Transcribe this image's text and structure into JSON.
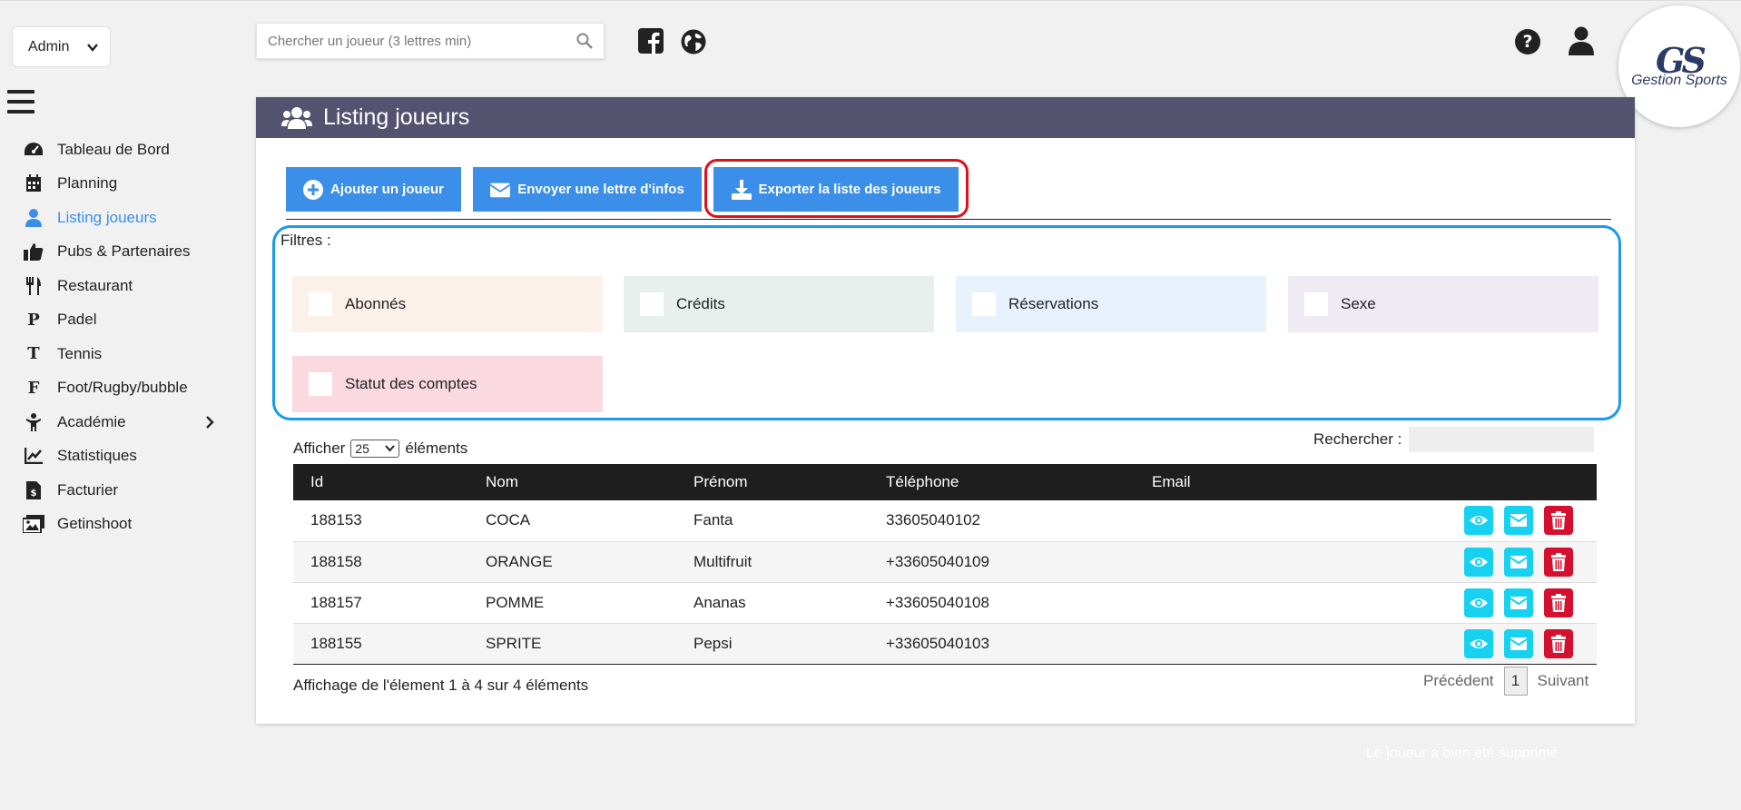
{
  "topbar": {
    "role_select": "Admin",
    "search_placeholder": "Chercher un joueur (3 lettres min)",
    "logo_name": "Gestion Sports",
    "logo_monogram": "GS"
  },
  "sidebar": {
    "items": [
      {
        "label": "Tableau de Bord",
        "icon": "dashboard-icon"
      },
      {
        "label": "Planning",
        "icon": "calendar-icon"
      },
      {
        "label": "Listing joueurs",
        "icon": "user-icon",
        "active": true
      },
      {
        "label": "Pubs & Partenaires",
        "icon": "thumbs-up-icon"
      },
      {
        "label": "Restaurant",
        "icon": "utensils-icon"
      },
      {
        "label": "Padel",
        "icon": "letter-p-icon",
        "glyph": "P"
      },
      {
        "label": "Tennis",
        "icon": "letter-t-icon",
        "glyph": "T"
      },
      {
        "label": "Foot/Rugby/bubble",
        "icon": "letter-f-icon",
        "glyph": "F"
      },
      {
        "label": "Académie",
        "icon": "child-icon"
      },
      {
        "label": "Statistiques",
        "icon": "chart-line-icon"
      },
      {
        "label": "Facturier",
        "icon": "invoice-icon"
      },
      {
        "label": "Getinshoot",
        "icon": "images-icon"
      }
    ]
  },
  "main": {
    "title": "Listing joueurs",
    "buttons": {
      "add": "Ajouter un joueur",
      "mail": "Envoyer une lettre d'infos",
      "export": "Exporter la liste des joueurs"
    },
    "filters_label": "Filtres :",
    "filters": [
      "Abonnés",
      "Crédits",
      "Réservations",
      "Sexe",
      "Statut des comptes"
    ],
    "show": {
      "before": "Afficher",
      "value": "25",
      "after": "éléments"
    },
    "search_label": "Rechercher :",
    "columns": [
      "Id",
      "Nom",
      "Prénom",
      "Téléphone",
      "Email"
    ],
    "rows": [
      {
        "id": "188153",
        "nom": "COCA",
        "prenom": "Fanta",
        "tel": "33605040102",
        "email": ""
      },
      {
        "id": "188158",
        "nom": "ORANGE",
        "prenom": "Multifruit",
        "tel": "+33605040109",
        "email": ""
      },
      {
        "id": "188157",
        "nom": "POMME",
        "prenom": "Ananas",
        "tel": "+33605040108",
        "email": ""
      },
      {
        "id": "188155",
        "nom": "SPRITE",
        "prenom": "Pepsi",
        "tel": "+33605040103",
        "email": ""
      }
    ],
    "info": "Affichage de l'élement 1 à 4 sur 4 éléments",
    "pager": {
      "prev": "Précédent",
      "page": "1",
      "next": "Suivant"
    }
  },
  "toast": "Le joueur a bien été supprimé",
  "colors": {
    "accent": "#3b8fe8",
    "header": "#535370",
    "highlight_red": "#e0101a",
    "highlight_blue": "#1a9be6",
    "action_cyan": "#16d2f0",
    "action_red": "#d4102e"
  }
}
